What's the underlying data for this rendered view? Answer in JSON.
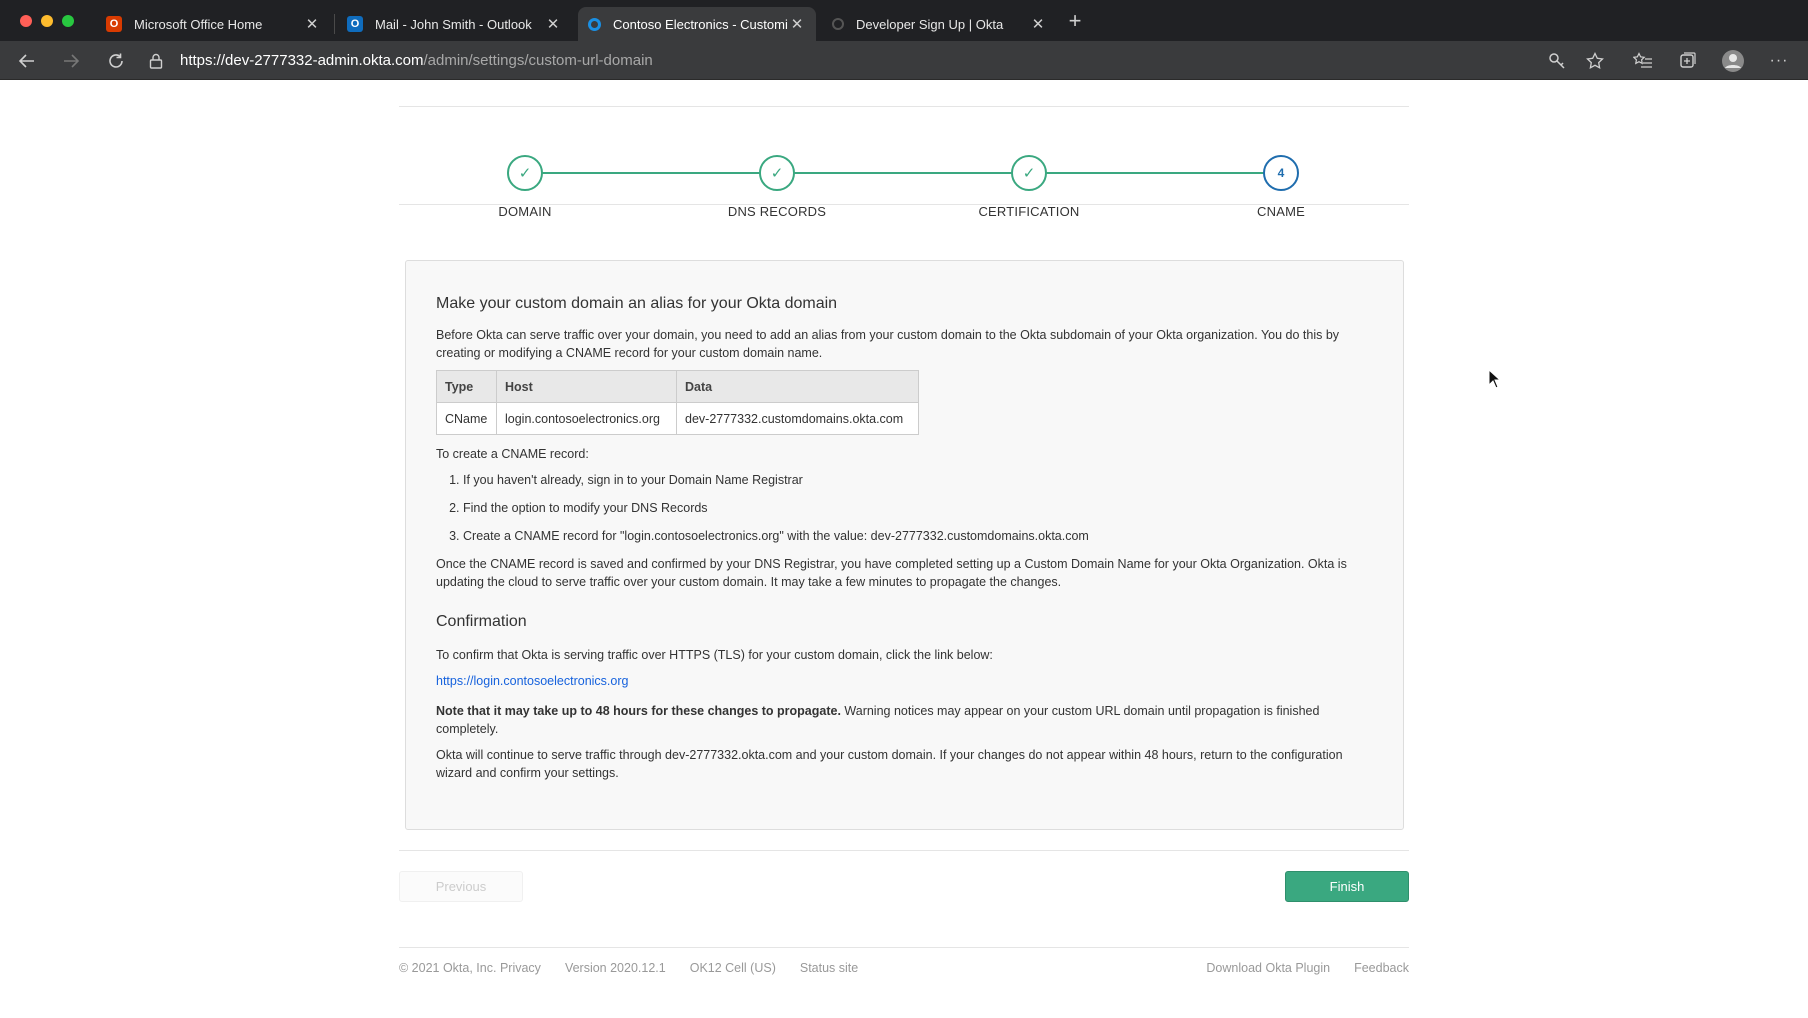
{
  "browser": {
    "tabs": [
      {
        "title": "Microsoft Office Home",
        "icon": "office-icon",
        "active": false
      },
      {
        "title": "Mail - John Smith - Outlook",
        "icon": "outlook-icon",
        "active": false
      },
      {
        "title": "Contoso Electronics - Customi",
        "icon": "okta-icon",
        "active": true
      },
      {
        "title": "Developer Sign Up | Okta",
        "icon": "okta-dev-icon",
        "active": false
      }
    ],
    "url_host": "https://dev-2777332-admin.okta.com",
    "url_path": "/admin/settings/custom-url-domain"
  },
  "wizard": {
    "steps": [
      {
        "label": "DOMAIN",
        "state": "done"
      },
      {
        "label": "DNS RECORDS",
        "state": "done"
      },
      {
        "label": "CERTIFICATION",
        "state": "done"
      },
      {
        "label": "CNAME",
        "state": "current",
        "number": "4"
      }
    ]
  },
  "panel": {
    "heading": "Make your custom domain an alias for your Okta domain",
    "intro": "Before Okta can serve traffic over your domain, you need to add an alias from your custom domain to the Okta subdomain of your Okta organization. You do this by creating or modifying a CNAME record for your custom domain name.",
    "table": {
      "headers": [
        "Type",
        "Host",
        "Data"
      ],
      "rows": [
        [
          "CName",
          "login.contosoelectronics.org",
          "dev-2777332.customdomains.okta.com"
        ]
      ]
    },
    "steps_intro": "To create a CNAME record:",
    "steps": [
      "If you haven't already, sign in to your Domain Name Registrar",
      "Find the option to modify your DNS Records",
      "Create a CNAME record for \"login.contosoelectronics.org\" with the value: dev-2777332.customdomains.okta.com"
    ],
    "completion": "Once the CNAME record is saved and confirmed by your DNS Registrar, you have completed setting up a Custom Domain Name for your Okta Organization. Okta is updating the cloud to serve traffic over your custom domain. It may take a few minutes to propagate the changes.",
    "confirmation_heading": "Confirmation",
    "confirmation_text": "To confirm that Okta is serving traffic over HTTPS (TLS) for your custom domain, click the link below:",
    "confirmation_link": "https://login.contosoelectronics.org",
    "note_bold": "Note that it may take up to 48 hours for these changes to propagate.",
    "note_rest": " Warning notices may appear on your custom URL domain until propagation is finished completely.",
    "final": "Okta will continue to serve traffic through dev-2777332.okta.com and your custom domain. If your changes do not appear within 48 hours, return to the configuration wizard and confirm your settings."
  },
  "buttons": {
    "previous": "Previous",
    "finish": "Finish"
  },
  "footer": {
    "copyright": "© 2021 Okta, Inc.",
    "privacy": "Privacy",
    "version": "Version 2020.12.1",
    "cell": "OK12 Cell (US)",
    "status": "Status site",
    "plugin": "Download Okta Plugin",
    "feedback": "Feedback"
  }
}
